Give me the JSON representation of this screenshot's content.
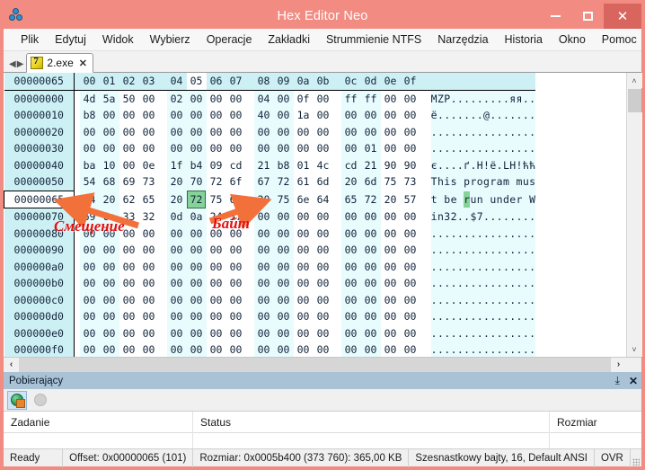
{
  "window": {
    "title": "Hex Editor Neo",
    "app_icon": "molecule-icon",
    "minimize_label": "–",
    "maximize_label": "□",
    "close_label": "✕",
    "titlebar_color": "#f28b82",
    "close_button_color": "#d9665e"
  },
  "menubar": {
    "items": [
      {
        "label": "Plik"
      },
      {
        "label": "Edytuj"
      },
      {
        "label": "Widok"
      },
      {
        "label": "Wybierz"
      },
      {
        "label": "Operacje"
      },
      {
        "label": "Zakładki"
      },
      {
        "label": "Strummienie NTFS"
      },
      {
        "label": "Narzędzia"
      },
      {
        "label": "Historia"
      },
      {
        "label": "Okno"
      },
      {
        "label": "Pomoc"
      }
    ]
  },
  "tabstrip": {
    "nav_prev": "◀",
    "nav_next": "▶",
    "tabs": [
      {
        "label": "2.exe",
        "icon": "archive-file-icon",
        "close_label": "✕",
        "active": true
      }
    ]
  },
  "hex_editor": {
    "header_offset_label": "00000065",
    "column_headers": [
      "00",
      "01",
      "02",
      "03",
      "04",
      "05",
      "06",
      "07",
      "08",
      "09",
      "0a",
      "0b",
      "0c",
      "0d",
      "0e",
      "0f"
    ],
    "highlighted_column": "05",
    "current_row_offset": "00000065",
    "selected_byte": {
      "value": "72",
      "column_index": 5,
      "row_offset": "00000065",
      "ascii": "r",
      "color": "#86d39a"
    },
    "rows": [
      {
        "offset": "00000000",
        "bytes": [
          "4d",
          "5a",
          "50",
          "00",
          "02",
          "00",
          "00",
          "00",
          "04",
          "00",
          "0f",
          "00",
          "ff",
          "ff",
          "00",
          "00"
        ],
        "ascii": "MZP.........яя.."
      },
      {
        "offset": "00000010",
        "bytes": [
          "b8",
          "00",
          "00",
          "00",
          "00",
          "00",
          "00",
          "00",
          "40",
          "00",
          "1a",
          "00",
          "00",
          "00",
          "00",
          "00"
        ],
        "ascii": "ё.......@......."
      },
      {
        "offset": "00000020",
        "bytes": [
          "00",
          "00",
          "00",
          "00",
          "00",
          "00",
          "00",
          "00",
          "00",
          "00",
          "00",
          "00",
          "00",
          "00",
          "00",
          "00"
        ],
        "ascii": "................"
      },
      {
        "offset": "00000030",
        "bytes": [
          "00",
          "00",
          "00",
          "00",
          "00",
          "00",
          "00",
          "00",
          "00",
          "00",
          "00",
          "00",
          "00",
          "01",
          "00",
          "00"
        ],
        "ascii": "................"
      },
      {
        "offset": "00000040",
        "bytes": [
          "ba",
          "10",
          "00",
          "0e",
          "1f",
          "b4",
          "09",
          "cd",
          "21",
          "b8",
          "01",
          "4c",
          "cd",
          "21",
          "90",
          "90"
        ],
        "ascii": "є....ґ.H!ё.LH!ћћ"
      },
      {
        "offset": "00000050",
        "bytes": [
          "54",
          "68",
          "69",
          "73",
          "20",
          "70",
          "72",
          "6f",
          "67",
          "72",
          "61",
          "6d",
          "20",
          "6d",
          "75",
          "73"
        ],
        "ascii": "This program mus"
      },
      {
        "offset": "00000065",
        "bytes": [
          "74",
          "20",
          "62",
          "65",
          "20",
          "72",
          "75",
          "6e",
          "20",
          "75",
          "6e",
          "64",
          "65",
          "72",
          "20",
          "57"
        ],
        "ascii": "t be run under W"
      },
      {
        "offset": "00000070",
        "bytes": [
          "69",
          "6e",
          "33",
          "32",
          "0d",
          "0a",
          "24",
          "37",
          "00",
          "00",
          "00",
          "00",
          "00",
          "00",
          "00",
          "00"
        ],
        "ascii": "in32..$7........"
      },
      {
        "offset": "00000080",
        "bytes": [
          "00",
          "00",
          "00",
          "00",
          "00",
          "00",
          "00",
          "00",
          "00",
          "00",
          "00",
          "00",
          "00",
          "00",
          "00",
          "00"
        ],
        "ascii": "................"
      },
      {
        "offset": "00000090",
        "bytes": [
          "00",
          "00",
          "00",
          "00",
          "00",
          "00",
          "00",
          "00",
          "00",
          "00",
          "00",
          "00",
          "00",
          "00",
          "00",
          "00"
        ],
        "ascii": "................"
      },
      {
        "offset": "000000a0",
        "bytes": [
          "00",
          "00",
          "00",
          "00",
          "00",
          "00",
          "00",
          "00",
          "00",
          "00",
          "00",
          "00",
          "00",
          "00",
          "00",
          "00"
        ],
        "ascii": "................"
      },
      {
        "offset": "000000b0",
        "bytes": [
          "00",
          "00",
          "00",
          "00",
          "00",
          "00",
          "00",
          "00",
          "00",
          "00",
          "00",
          "00",
          "00",
          "00",
          "00",
          "00"
        ],
        "ascii": "................"
      },
      {
        "offset": "000000c0",
        "bytes": [
          "00",
          "00",
          "00",
          "00",
          "00",
          "00",
          "00",
          "00",
          "00",
          "00",
          "00",
          "00",
          "00",
          "00",
          "00",
          "00"
        ],
        "ascii": "................"
      },
      {
        "offset": "000000d0",
        "bytes": [
          "00",
          "00",
          "00",
          "00",
          "00",
          "00",
          "00",
          "00",
          "00",
          "00",
          "00",
          "00",
          "00",
          "00",
          "00",
          "00"
        ],
        "ascii": "................"
      },
      {
        "offset": "000000e0",
        "bytes": [
          "00",
          "00",
          "00",
          "00",
          "00",
          "00",
          "00",
          "00",
          "00",
          "00",
          "00",
          "00",
          "00",
          "00",
          "00",
          "00"
        ],
        "ascii": "................"
      },
      {
        "offset": "000000f0",
        "bytes": [
          "00",
          "00",
          "00",
          "00",
          "00",
          "00",
          "00",
          "00",
          "00",
          "00",
          "00",
          "00",
          "00",
          "00",
          "00",
          "00"
        ],
        "ascii": "................"
      }
    ],
    "scroll": {
      "up_arrow": "˄",
      "down_arrow": "˅",
      "left_arrow": "‹",
      "right_arrow": "›"
    }
  },
  "annotations": {
    "color": "#e31010",
    "arrow_color": "#f2703a",
    "items": [
      {
        "text": "Смещение",
        "points_to": "offset-column"
      },
      {
        "text": "Байт",
        "points_to": "selected-byte"
      }
    ]
  },
  "downloader_pane": {
    "title": "Pobierający",
    "pin_label": "⤓",
    "close_label": "✕",
    "toolbar": [
      {
        "icon": "globe-download-icon",
        "active": true
      },
      {
        "icon": "globe-disabled-icon",
        "active": false
      }
    ],
    "grid_headers": [
      "Zadanie",
      "Status",
      "Rozmiar"
    ],
    "rows": []
  },
  "statusbar": {
    "state": "Ready",
    "offset": "Offset: 0x00000065 (101)",
    "size": "Rozmiar: 0x0005b400 (373 760): 365,00 KB",
    "mode": "Szesnastkowy bajty, 16, Default ANSI",
    "insert_mode": "OVR"
  }
}
